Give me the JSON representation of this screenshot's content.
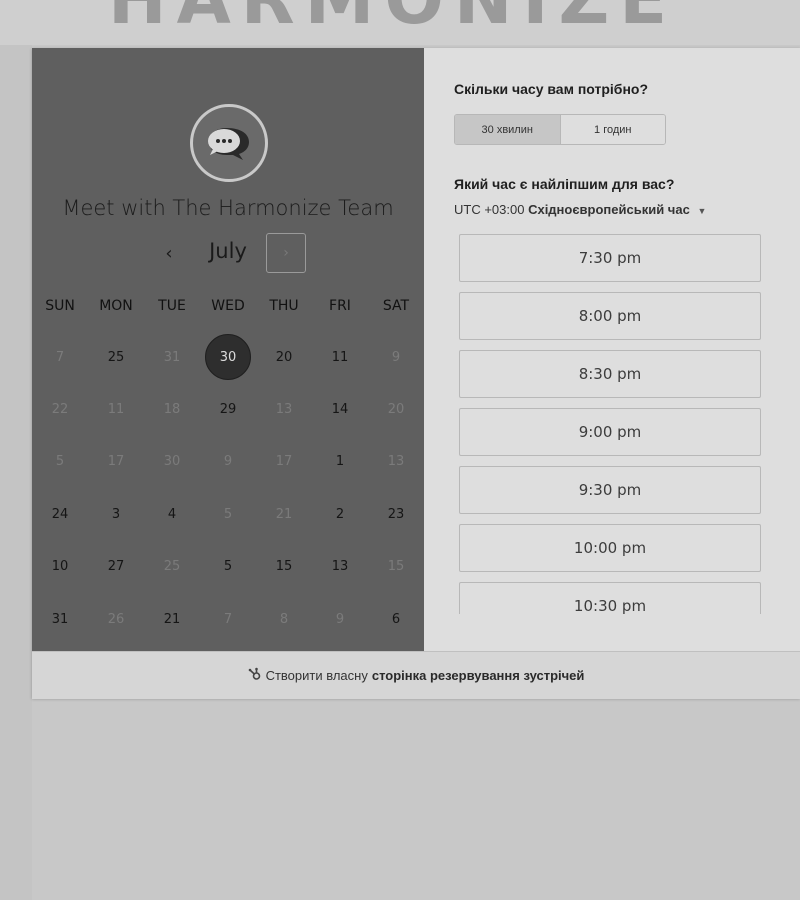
{
  "header": {
    "brand_ghost": "HARMONIZE"
  },
  "calendar": {
    "meeting_title": "Meet with The Harmonize Team",
    "month": "July",
    "prev_icon": "‹",
    "next_icon": "›",
    "weekdays": [
      "SUN",
      "MON",
      "TUE",
      "WED",
      "THU",
      "FRI",
      "SAT"
    ],
    "rows": [
      [
        {
          "d": "7",
          "s": "muted"
        },
        {
          "d": "25",
          "s": "available"
        },
        {
          "d": "31",
          "s": "muted"
        },
        {
          "d": "30",
          "s": "selected"
        },
        {
          "d": "20",
          "s": "available"
        },
        {
          "d": "11",
          "s": "available"
        },
        {
          "d": "9",
          "s": "muted"
        }
      ],
      [
        {
          "d": "22",
          "s": "muted"
        },
        {
          "d": "11",
          "s": "muted"
        },
        {
          "d": "18",
          "s": "muted"
        },
        {
          "d": "29",
          "s": "available"
        },
        {
          "d": "13",
          "s": "muted"
        },
        {
          "d": "14",
          "s": "available"
        },
        {
          "d": "20",
          "s": "muted"
        }
      ],
      [
        {
          "d": "5",
          "s": "muted"
        },
        {
          "d": "17",
          "s": "muted"
        },
        {
          "d": "30",
          "s": "muted"
        },
        {
          "d": "9",
          "s": "muted"
        },
        {
          "d": "17",
          "s": "muted"
        },
        {
          "d": "1",
          "s": "available"
        },
        {
          "d": "13",
          "s": "muted"
        }
      ],
      [
        {
          "d": "24",
          "s": "available"
        },
        {
          "d": "3",
          "s": "available"
        },
        {
          "d": "4",
          "s": "available"
        },
        {
          "d": "5",
          "s": "muted"
        },
        {
          "d": "21",
          "s": "muted"
        },
        {
          "d": "2",
          "s": "available"
        },
        {
          "d": "23",
          "s": "available"
        }
      ],
      [
        {
          "d": "10",
          "s": "available"
        },
        {
          "d": "27",
          "s": "available"
        },
        {
          "d": "25",
          "s": "muted"
        },
        {
          "d": "5",
          "s": "available"
        },
        {
          "d": "15",
          "s": "available"
        },
        {
          "d": "13",
          "s": "available"
        },
        {
          "d": "15",
          "s": "muted"
        }
      ],
      [
        {
          "d": "31",
          "s": "available"
        },
        {
          "d": "26",
          "s": "muted"
        },
        {
          "d": "21",
          "s": "available"
        },
        {
          "d": "7",
          "s": "muted"
        },
        {
          "d": "8",
          "s": "muted"
        },
        {
          "d": "9",
          "s": "muted"
        },
        {
          "d": "6",
          "s": "available"
        }
      ]
    ]
  },
  "booking": {
    "duration_question": "Скільки часу вам потрібно?",
    "durations": [
      "30 хвилин",
      "1 годин"
    ],
    "selected_duration": "30 хвилин",
    "time_question": "Який час є найліпшим для вас?",
    "timezone_prefix": "UTC +03:00",
    "timezone_name": "Східноєвропейський час",
    "slots": [
      "7:30 pm",
      "8:00 pm",
      "8:30 pm",
      "9:00 pm",
      "9:30 pm",
      "10:00 pm",
      "10:30 pm"
    ]
  },
  "footer": {
    "prefix": "Створити власну",
    "link": "сторінка резервування зустрічей"
  },
  "colors": {
    "left_panel": "#5f5f5f",
    "selected_day": "#2e2e2e",
    "page_bg": "#c8c8c8",
    "card_bg": "#dedede"
  },
  "icons": {
    "avatar": "chat-bubble-icon",
    "prev": "chevron-left-icon",
    "next": "chevron-right-icon",
    "timezone": "caret-down-icon",
    "footer": "hubspot-sprocket-icon"
  }
}
